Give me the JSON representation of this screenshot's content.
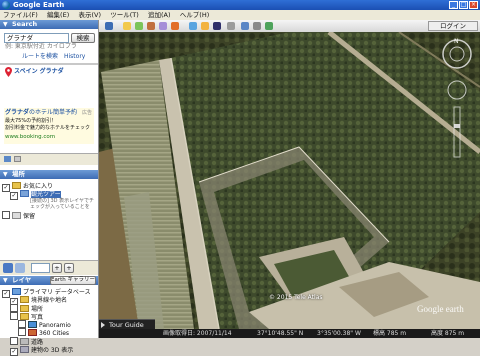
{
  "window": {
    "title": "Google Earth"
  },
  "menu": [
    "ファイル(F)",
    "編集(E)",
    "表示(V)",
    "ツール(T)",
    "追加(A)",
    "ヘルプ(H)"
  ],
  "search": {
    "header": "Search",
    "query": "グラナダ",
    "search_button": "検索",
    "example": "例: 東京駅付近 カイロプラ",
    "route_link": "ルートを検索",
    "history_link": "History",
    "result_title": "スペイン グラナダ",
    "ad_title": "グラナダ",
    "ad_title_rest": "のホテル簡単予約",
    "ad_badge": "広告",
    "ad_line1": "最大75%の予約割引！",
    "ad_line2": "割引料金で魅力的なホテルをチェック",
    "ad_url": "www.booking.com"
  },
  "places": {
    "header": "場所",
    "favorites": "お気に入り",
    "sightseeing": "観光ツアー",
    "sightseeing_note": "[接続の] 3D 表示レイヤでチェックが入っていることを",
    "saved": "保留"
  },
  "layers": {
    "header": "レイヤ",
    "gallery_button": "Earth ギャラリー",
    "items": [
      {
        "label": "プライマリ データベース"
      },
      {
        "label": "境界線や地名"
      },
      {
        "label": "場所"
      },
      {
        "label": "写真"
      },
      {
        "label": "Panoramio"
      },
      {
        "label": "360 Cities"
      },
      {
        "label": "道路"
      },
      {
        "label": "建物の 3D 表示"
      }
    ]
  },
  "toolbar": {
    "login": "ログイン"
  },
  "map": {
    "copyright": "© 2015 Tele Atlas",
    "brand": "Google earth",
    "tour_guide": "Tour Guide"
  },
  "status": {
    "date": "画像取得日: 2007/11/14",
    "lat": "37°10'48.55\" N",
    "lon": "3°35'00.38\" W",
    "elev": "標高 785 m",
    "eye": "高度 875 m"
  },
  "colors": {
    "accent": "#3d6cb4",
    "titlebar": "#1b4fb3"
  }
}
